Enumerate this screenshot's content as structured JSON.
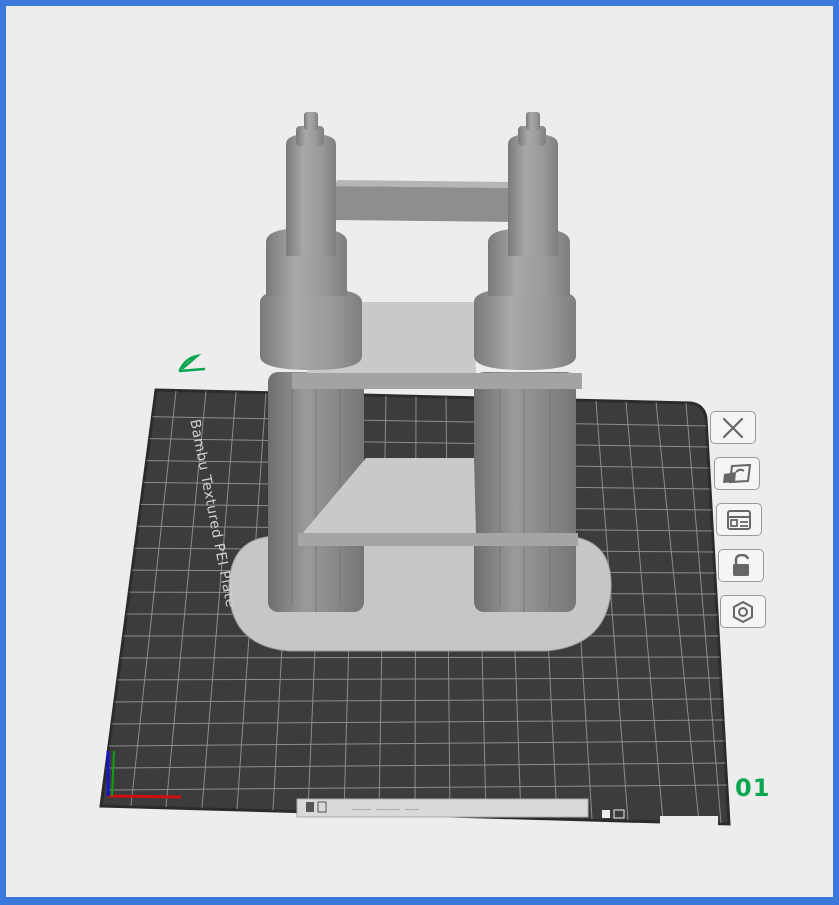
{
  "plate": {
    "label": "Bambu Textured PEI Plate",
    "number": "01",
    "bottom_label": "~~~~ ~~~~~ ~~~"
  },
  "toolbar": {
    "buttons": [
      {
        "name": "delete-plate-button",
        "icon": "close-icon"
      },
      {
        "name": "auto-orient-button",
        "icon": "orient-icon"
      },
      {
        "name": "arrange-button",
        "icon": "arrange-icon"
      },
      {
        "name": "lock-plate-button",
        "icon": "unlock-icon"
      },
      {
        "name": "plate-settings-button",
        "icon": "hexagon-nut-icon"
      }
    ]
  },
  "colors": {
    "background": "#ededed",
    "frame": "#3b78dc",
    "plate": "#3c3c3c",
    "grid": "#8c8c8c",
    "model": "#9c9c9c",
    "accent": "#0aa650"
  }
}
